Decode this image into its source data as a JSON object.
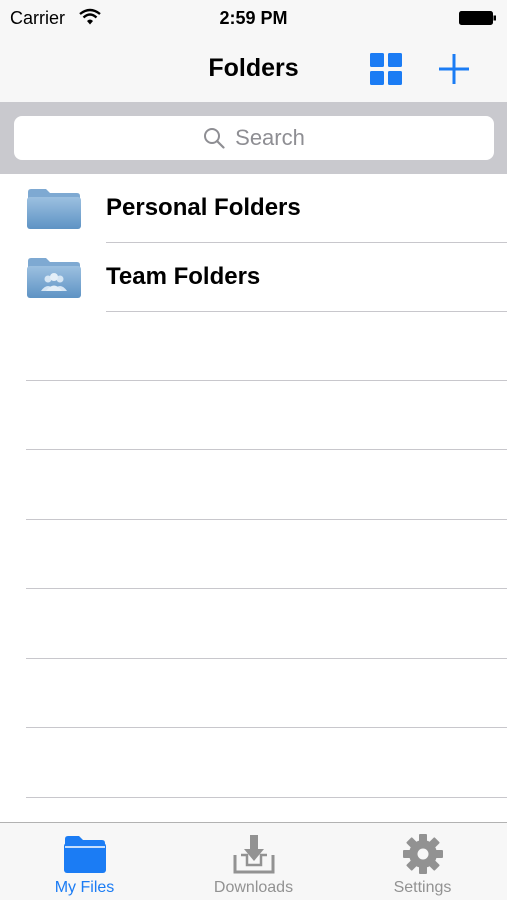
{
  "status_bar": {
    "carrier": "Carrier",
    "time": "2:59 PM"
  },
  "nav_bar": {
    "title": "Folders",
    "grid_icon": "grid-view-icon",
    "add_icon": "plus-icon",
    "accent_color": "#1b7cf4"
  },
  "search": {
    "placeholder": "Search"
  },
  "folders": [
    {
      "label": "Personal Folders",
      "icon": "folder-icon"
    },
    {
      "label": "Team Folders",
      "icon": "team-folder-icon"
    }
  ],
  "tab_bar": {
    "tabs": [
      {
        "label": "My Files",
        "icon": "folder-icon",
        "active": true
      },
      {
        "label": "Downloads",
        "icon": "download-icon",
        "active": false
      },
      {
        "label": "Settings",
        "icon": "gear-icon",
        "active": false
      }
    ]
  }
}
